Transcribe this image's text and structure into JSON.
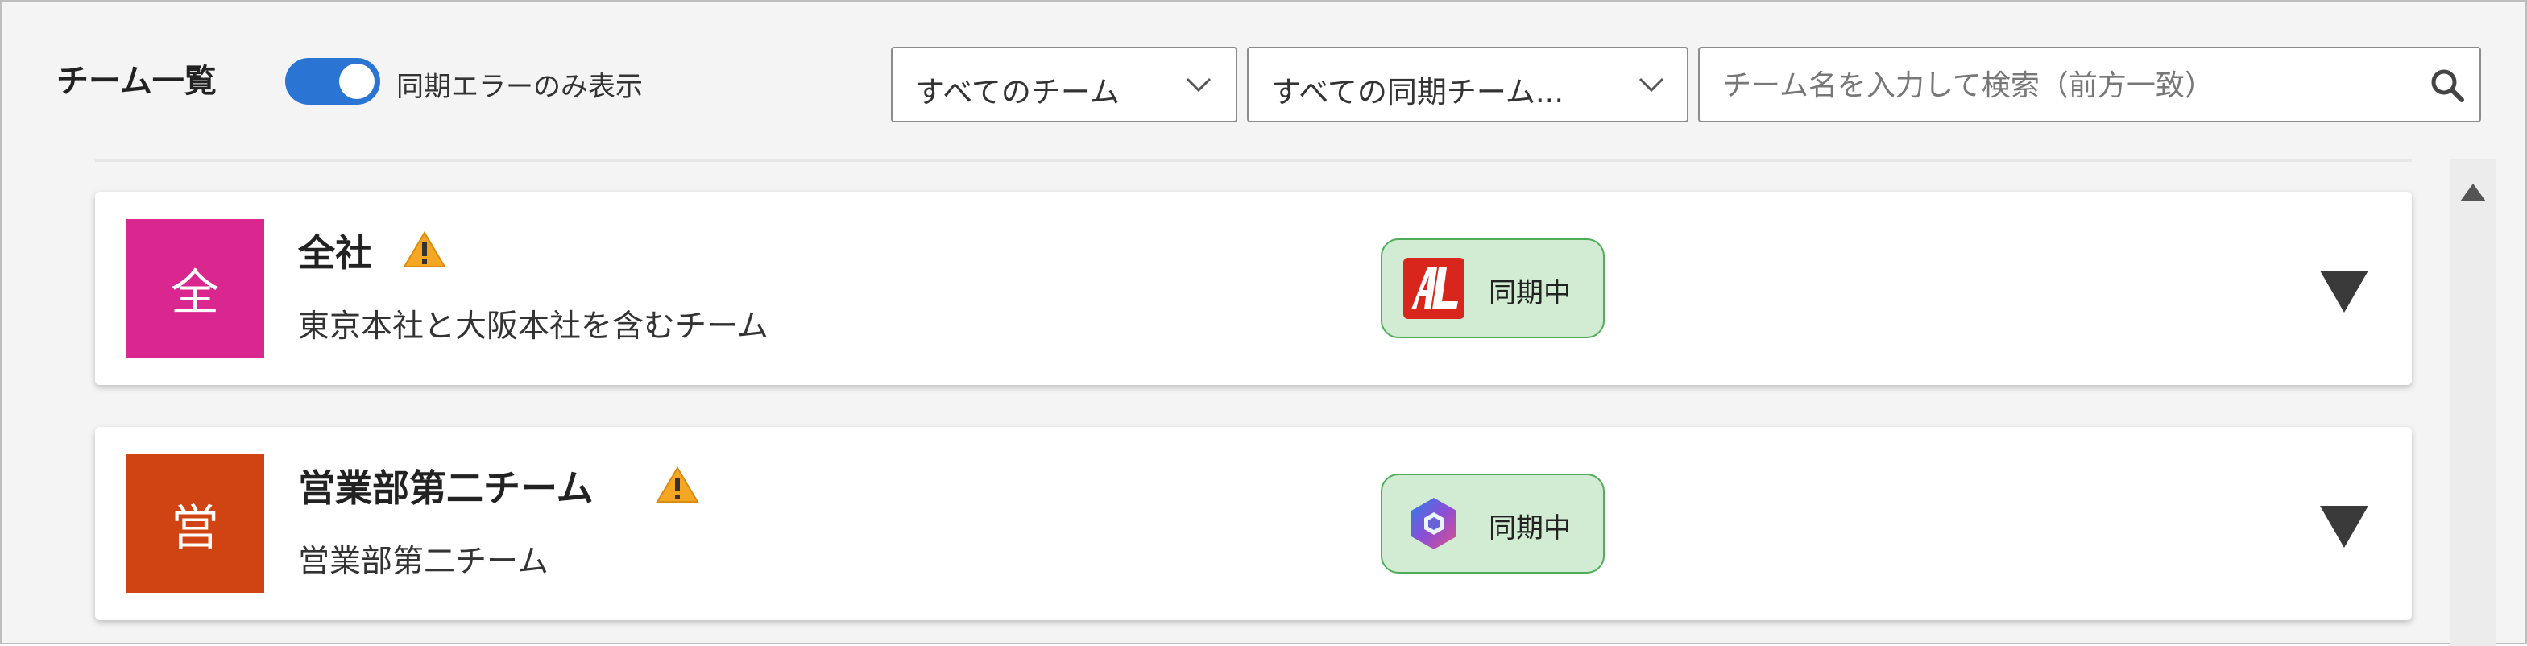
{
  "header": {
    "title": "チーム一覧",
    "toggle_label": "同期エラーのみ表示",
    "toggle_on": true,
    "filter_team": "すべてのチーム",
    "filter_sync": "すべての同期チーム...",
    "search_placeholder": "チーム名を入力して検索（前方一致）"
  },
  "colors": {
    "accent": "#2a74d4",
    "badge_bg": "#d1ecd3",
    "badge_border": "#4fad5a",
    "warning": "#f5a623"
  },
  "teams": [
    {
      "avatar_char": "全",
      "avatar_color": "#d9278f",
      "name": "全社",
      "description": "東京本社と大阪本社を含むチーム",
      "warning": true,
      "sync_service_icon": "al-logo-icon",
      "status": "同期中"
    },
    {
      "avatar_char": "営",
      "avatar_color": "#d04414",
      "name": "営業部第二チーム",
      "description": "営業部第二チーム",
      "warning": true,
      "sync_service_icon": "microsoft-365-icon",
      "status": "同期中"
    }
  ]
}
